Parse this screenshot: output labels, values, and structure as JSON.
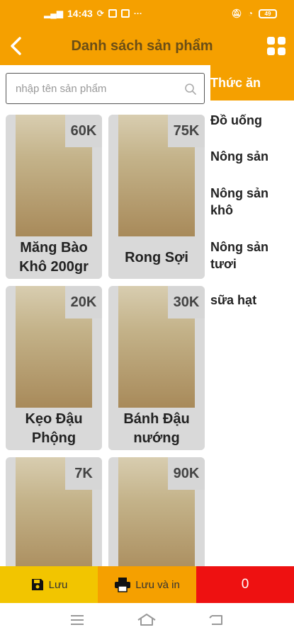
{
  "status_bar": {
    "time": "14:43",
    "battery": "49"
  },
  "header": {
    "title": "Danh sách sản phẩm",
    "back_icon": "chevron-left-icon",
    "menu_icon": "grid-icon"
  },
  "search": {
    "placeholder": "nhập tên sản phẩm",
    "value": ""
  },
  "categories": [
    {
      "label": "Thức ăn",
      "active": true
    },
    {
      "label": "Đồ uống"
    },
    {
      "label": "Nông sản"
    },
    {
      "label": "Nông sản khô"
    },
    {
      "label": "Nông sản tươi"
    },
    {
      "label": "sữa hạt"
    }
  ],
  "products": [
    {
      "name": "Măng Bào Khô 200gr",
      "price": "60K"
    },
    {
      "name": "Rong Sợi",
      "price": "75K"
    },
    {
      "name": "Kẹo Đậu Phộng",
      "price": "20K"
    },
    {
      "name": "Bánh Đậu nướng",
      "price": "30K"
    },
    {
      "name": "",
      "price": "7K"
    },
    {
      "name": "",
      "price": "90K"
    }
  ],
  "actions": {
    "save": "Lưu",
    "save_print": "Lưu và in",
    "total": "0"
  },
  "colors": {
    "primary": "#f5a000",
    "save": "#f2c500",
    "total": "#ee1111"
  }
}
